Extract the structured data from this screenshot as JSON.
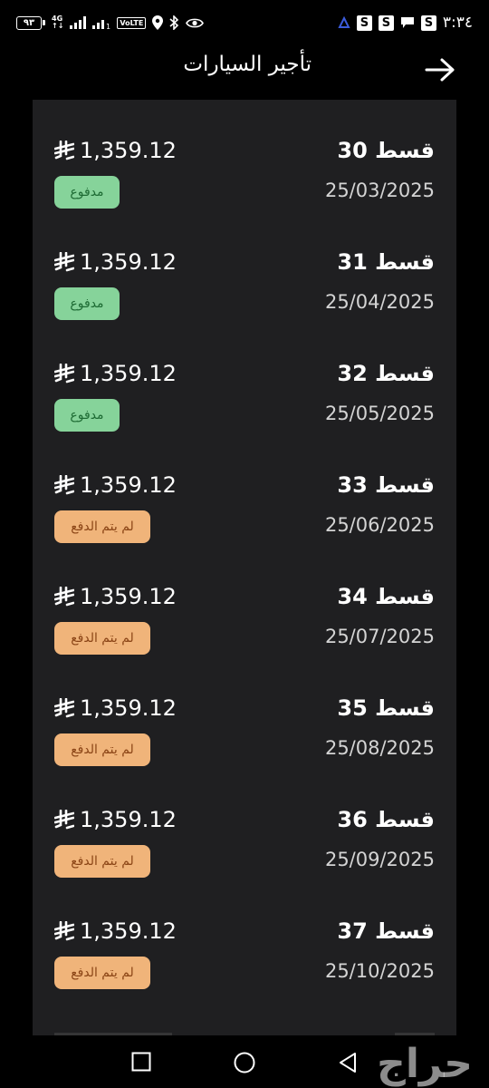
{
  "status_bar": {
    "time": "٣:٣٤",
    "battery_level": "٩٣",
    "network": "4G",
    "volte": "VoLTE",
    "sim_label": "1",
    "notification_s": [
      "S",
      "S",
      "S"
    ]
  },
  "header": {
    "title": "تأجير السيارات"
  },
  "installments": [
    {
      "title": "قسط 30",
      "date": "25/03/2025",
      "amount": "1,359.12",
      "status": "مدفوع",
      "paid": true
    },
    {
      "title": "قسط 31",
      "date": "25/04/2025",
      "amount": "1,359.12",
      "status": "مدفوع",
      "paid": true
    },
    {
      "title": "قسط 32",
      "date": "25/05/2025",
      "amount": "1,359.12",
      "status": "مدفوع",
      "paid": true
    },
    {
      "title": "قسط 33",
      "date": "25/06/2025",
      "amount": "1,359.12",
      "status": "لم يتم الدفع",
      "paid": false
    },
    {
      "title": "قسط 34",
      "date": "25/07/2025",
      "amount": "1,359.12",
      "status": "لم يتم الدفع",
      "paid": false
    },
    {
      "title": "قسط 35",
      "date": "25/08/2025",
      "amount": "1,359.12",
      "status": "لم يتم الدفع",
      "paid": false
    },
    {
      "title": "قسط 36",
      "date": "25/09/2025",
      "amount": "1,359.12",
      "status": "لم يتم الدفع",
      "paid": false
    },
    {
      "title": "قسط 37",
      "date": "25/10/2025",
      "amount": "1,359.12",
      "status": "لم يتم الدفع",
      "paid": false
    }
  ],
  "colors": {
    "background": "#000000",
    "panel": "#1f1f21",
    "paid_badge": "#86d39a",
    "unpaid_badge": "#f0b47a"
  },
  "watermark": "حراج"
}
